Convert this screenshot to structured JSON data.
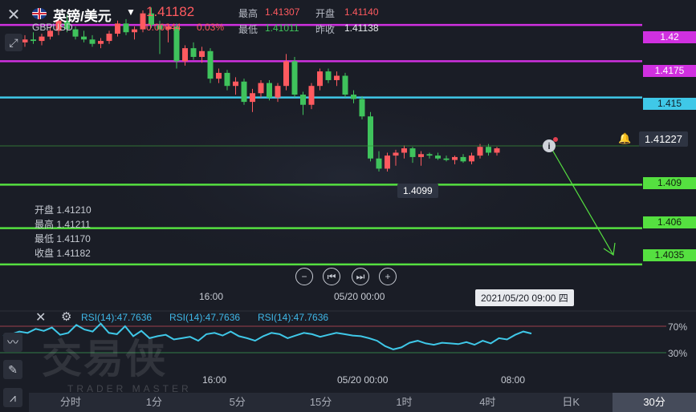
{
  "header": {
    "pair_title": "英镑/美元",
    "pair_code": "GBPUSD",
    "last_price": "1.41182",
    "change_abs": "0.00044",
    "change_pct": "0.03%",
    "high_label": "最高",
    "high_value": "1.41307",
    "open_label": "开盘",
    "open_value": "1.41140",
    "low_label": "最低",
    "low_value": "1.41011",
    "prev_close_label": "昨收",
    "prev_close_value": "1.41138"
  },
  "levels": [
    {
      "label": "1.42",
      "color": "#d030e0",
      "price": 1.42
    },
    {
      "label": "1.4175",
      "color": "#d030e0",
      "price": 1.4175
    },
    {
      "label": "1.415",
      "color": "#3fc8e8",
      "price": 1.415
    },
    {
      "label": "1.409",
      "color": "#55e040",
      "price": 1.409
    },
    {
      "label": "1.406",
      "color": "#55e040",
      "price": 1.406
    },
    {
      "label": "1.4035",
      "color": "#55e040",
      "price": 1.4035
    }
  ],
  "current_price_tag": "1.41227",
  "ohlc_panel": {
    "open": "开盘 1.41210",
    "high": "最高 1.41211",
    "low": "最低 1.41170",
    "close": "收盘 1.41182"
  },
  "low_marker": "1.4099",
  "crosshair_time": "2021/05/20 09:00 四",
  "time_axis": [
    "16:00",
    "05/20 00:00"
  ],
  "rsi_time_axis": [
    "16:00",
    "05/20 00:00",
    "08:00"
  ],
  "rsi": {
    "labels": [
      "RSI(14):47.7636",
      "RSI(14):47.7636",
      "RSI(14):47.7636"
    ],
    "upper": "70%",
    "lower": "30%",
    "values": [
      55,
      58,
      62,
      60,
      66,
      63,
      68,
      57,
      60,
      72,
      65,
      62,
      74,
      60,
      58,
      70,
      55,
      63,
      52,
      55,
      57,
      50,
      52,
      54,
      48,
      58,
      60,
      56,
      62,
      55,
      52,
      48,
      55,
      60,
      58,
      52,
      56,
      60,
      58,
      54,
      57,
      60,
      58,
      56,
      55,
      52,
      48,
      40,
      35,
      38,
      45,
      48,
      44,
      42,
      45,
      44,
      43,
      46,
      42,
      48,
      44,
      52,
      50,
      57,
      62,
      59
    ]
  },
  "tabs": [
    {
      "label": "分时",
      "active": false
    },
    {
      "label": "1分",
      "active": false
    },
    {
      "label": "5分",
      "active": false
    },
    {
      "label": "15分",
      "active": false
    },
    {
      "label": "1时",
      "active": false
    },
    {
      "label": "4时",
      "active": false
    },
    {
      "label": "日K",
      "active": false
    },
    {
      "label": "30分",
      "active": true
    }
  ],
  "watermark": {
    "main": "交易侠",
    "sub": "TRADER MASTER"
  },
  "colors": {
    "up": "#ff5a5f",
    "down": "#3fc35c",
    "background": "#1a1d26"
  },
  "chart_data": {
    "type": "candlestick",
    "y_range": [
      1.4025,
      1.4215
    ],
    "candles": [
      [
        1.4188,
        1.4192,
        1.4184,
        1.4186
      ],
      [
        1.4186,
        1.419,
        1.4183,
        1.4188
      ],
      [
        1.4188,
        1.4193,
        1.4185,
        1.419
      ],
      [
        1.419,
        1.4195,
        1.4187,
        1.4189
      ],
      [
        1.4189,
        1.4194,
        1.4186,
        1.4192
      ],
      [
        1.4192,
        1.4199,
        1.419,
        1.4196
      ],
      [
        1.4196,
        1.4205,
        1.4193,
        1.4203
      ],
      [
        1.4203,
        1.4207,
        1.4195,
        1.4197
      ],
      [
        1.4197,
        1.4199,
        1.419,
        1.4192
      ],
      [
        1.4192,
        1.4196,
        1.4188,
        1.419
      ],
      [
        1.419,
        1.4193,
        1.4185,
        1.4187
      ],
      [
        1.4187,
        1.4191,
        1.4184,
        1.4189
      ],
      [
        1.4189,
        1.4196,
        1.4187,
        1.4194
      ],
      [
        1.4194,
        1.4203,
        1.4192,
        1.4201
      ],
      [
        1.4201,
        1.4204,
        1.4193,
        1.4195
      ],
      [
        1.4195,
        1.4199,
        1.419,
        1.4197
      ],
      [
        1.4197,
        1.421,
        1.4195,
        1.4208
      ],
      [
        1.4208,
        1.4212,
        1.4198,
        1.42
      ],
      [
        1.42,
        1.4203,
        1.418,
        1.4197
      ],
      [
        1.4197,
        1.4201,
        1.4188,
        1.4199
      ],
      [
        1.4199,
        1.4201,
        1.417,
        1.4175
      ],
      [
        1.4175,
        1.4186,
        1.4172,
        1.4184
      ],
      [
        1.4184,
        1.4188,
        1.4176,
        1.4178
      ],
      [
        1.4178,
        1.4185,
        1.4174,
        1.4182
      ],
      [
        1.4182,
        1.4184,
        1.416,
        1.4163
      ],
      [
        1.4163,
        1.417,
        1.416,
        1.4167
      ],
      [
        1.4167,
        1.4169,
        1.4155,
        1.4158
      ],
      [
        1.4158,
        1.4164,
        1.4152,
        1.4161
      ],
      [
        1.4161,
        1.4163,
        1.4145,
        1.4147
      ],
      [
        1.4147,
        1.4156,
        1.414,
        1.4153
      ],
      [
        1.4153,
        1.4162,
        1.415,
        1.416
      ],
      [
        1.416,
        1.4162,
        1.4148,
        1.415
      ],
      [
        1.415,
        1.416,
        1.4147,
        1.4158
      ],
      [
        1.4158,
        1.418,
        1.4155,
        1.4175
      ],
      [
        1.4175,
        1.4178,
        1.415,
        1.4152
      ],
      [
        1.4152,
        1.4154,
        1.4138,
        1.4145
      ],
      [
        1.4145,
        1.416,
        1.4142,
        1.4158
      ],
      [
        1.4158,
        1.417,
        1.4155,
        1.4168
      ],
      [
        1.4168,
        1.417,
        1.416,
        1.4162
      ],
      [
        1.4162,
        1.4168,
        1.4158,
        1.4165
      ],
      [
        1.4165,
        1.4167,
        1.415,
        1.4152
      ],
      [
        1.4152,
        1.4155,
        1.4146,
        1.4149
      ],
      [
        1.4149,
        1.4151,
        1.4135,
        1.4137
      ],
      [
        1.4137,
        1.414,
        1.4106,
        1.4108
      ],
      [
        1.4108,
        1.4113,
        1.4099,
        1.4101
      ],
      [
        1.4101,
        1.4112,
        1.4099,
        1.411
      ],
      [
        1.411,
        1.4114,
        1.4103,
        1.4112
      ],
      [
        1.4112,
        1.4117,
        1.4108,
        1.4115
      ],
      [
        1.4115,
        1.4116,
        1.4105,
        1.4109
      ],
      [
        1.4109,
        1.4113,
        1.4103,
        1.4111
      ],
      [
        1.4111,
        1.4112,
        1.4108,
        1.411
      ],
      [
        1.411,
        1.4112,
        1.4107,
        1.4108
      ],
      [
        1.4108,
        1.411,
        1.4106,
        1.4107
      ],
      [
        1.4107,
        1.411,
        1.4104,
        1.4109
      ],
      [
        1.4109,
        1.4111,
        1.4105,
        1.4106
      ],
      [
        1.4106,
        1.4112,
        1.4104,
        1.411
      ],
      [
        1.411,
        1.4118,
        1.4108,
        1.4116
      ],
      [
        1.4116,
        1.4118,
        1.411,
        1.4112
      ],
      [
        1.4112,
        1.4116,
        1.411,
        1.4115
      ]
    ]
  }
}
